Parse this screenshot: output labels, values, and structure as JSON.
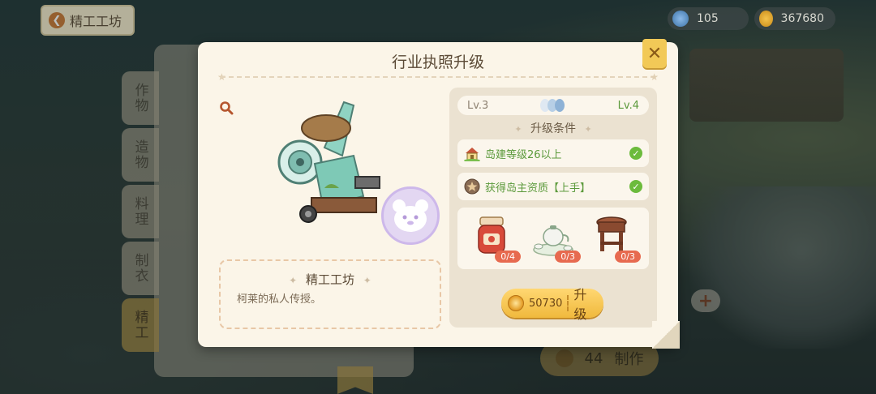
{
  "header": {
    "back_label": "精工工坊",
    "resource_1": "105",
    "resource_2": "367680"
  },
  "background": {
    "tabs": [
      "作物",
      "造物",
      "料理",
      "制衣",
      "精工"
    ],
    "active_tab": "精工",
    "craft_cost": "44",
    "craft_label": "制作"
  },
  "modal": {
    "title": "行业执照升级",
    "item_name": "精工工坊",
    "item_desc": "柯莱的私人传授。",
    "level_from": "Lv.3",
    "level_to": "Lv.4",
    "conditions_title": "升级条件",
    "conditions": [
      {
        "text": "岛建等级26以上",
        "icon": "house-icon",
        "done": true
      },
      {
        "text": "获得岛主资质【上手】",
        "icon": "star-badge-icon",
        "done": true
      }
    ],
    "materials": [
      {
        "name": "jam-jar",
        "count": "0/4"
      },
      {
        "name": "tea-set",
        "count": "0/3"
      },
      {
        "name": "wooden-stool",
        "count": "0/3"
      }
    ],
    "upgrade_cost": "50730",
    "upgrade_label": "升级"
  },
  "colors": {
    "accent": "#f2c957",
    "success": "#6cbb3c",
    "warning_badge": "#e76a4f"
  }
}
